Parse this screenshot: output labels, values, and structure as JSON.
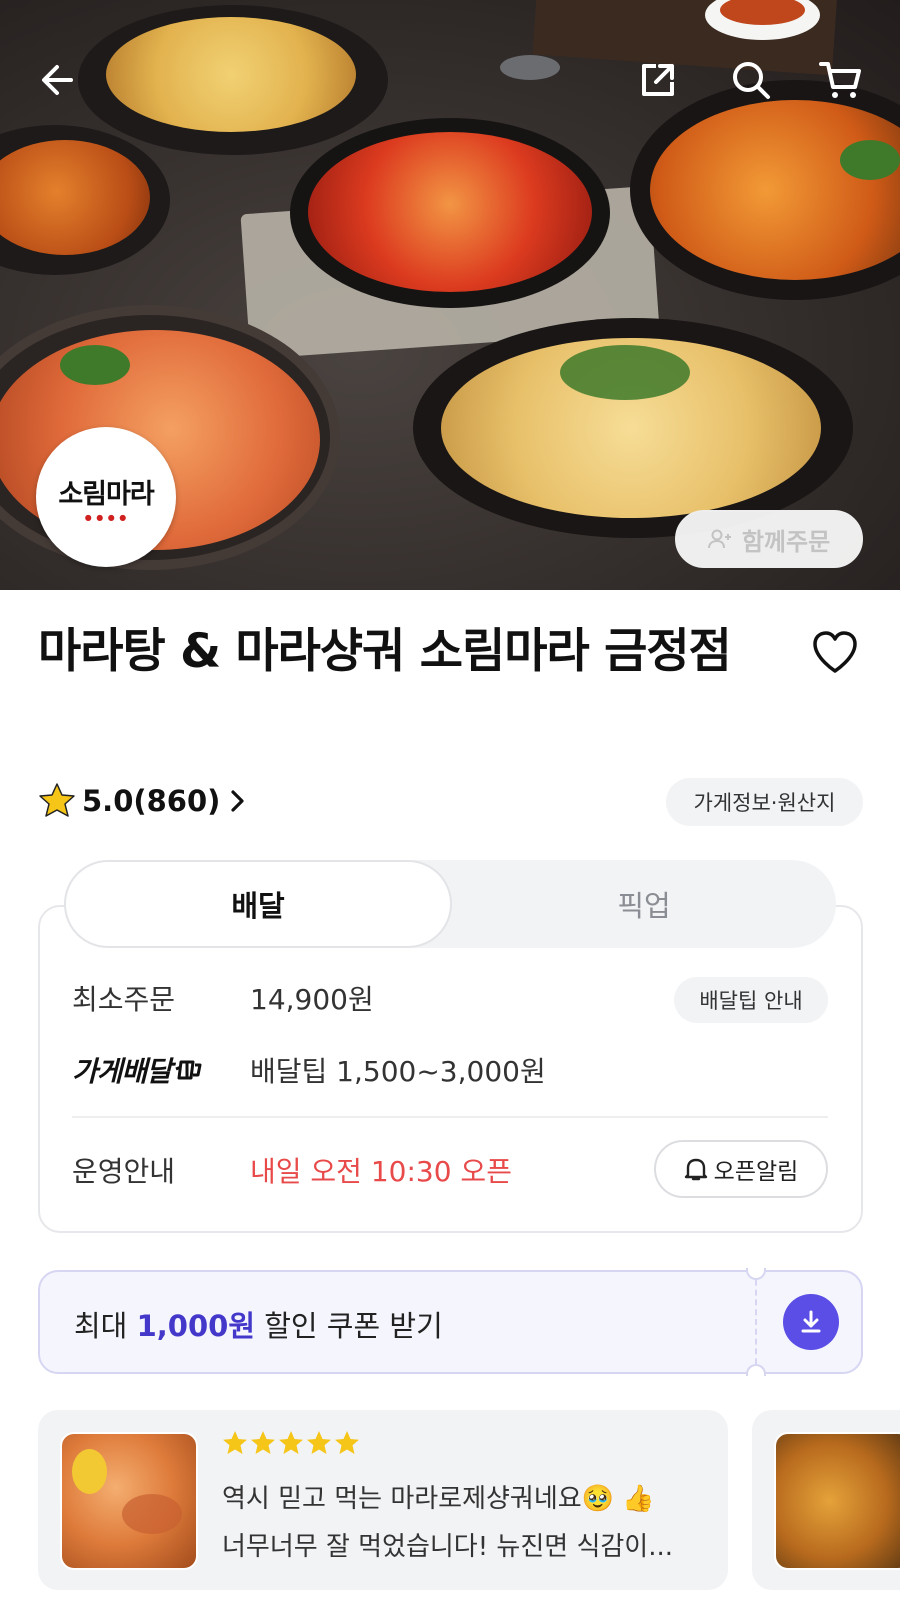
{
  "header": {
    "back_icon": "arrow-left-icon",
    "share_icon": "share-icon",
    "search_icon": "search-icon",
    "cart_icon": "cart-icon"
  },
  "hero": {
    "logo_text": "소림마라",
    "group_order_label": "함께주문"
  },
  "store": {
    "title": "마라탕 & 마라샹궈 소림마라 금정점",
    "rating": "5.0(860)",
    "info_chip": "가게정보·원산지"
  },
  "tabs": [
    {
      "label": "배달",
      "active": true
    },
    {
      "label": "픽업",
      "active": false
    }
  ],
  "delivery": {
    "min_order_label": "최소주문",
    "min_order_value": "14,900원",
    "tip_chip": "배달팁 안내",
    "store_delivery_label": "가게배달",
    "tip_value": "배달팁 1,500~3,000원",
    "hours_label": "운영안내",
    "hours_value": "내일 오전 10:30 오픈",
    "alert_label": "오픈알림"
  },
  "coupon": {
    "prefix": "최대 ",
    "amount": "1,000원",
    "suffix": " 할인 쿠폰 받기"
  },
  "review": {
    "stars": 5,
    "line1": "역시 믿고 먹는 마라로제샹궈네요🥹 👍",
    "line2": "너무너무 잘 먹었습니다! 뉴진면 식감이..."
  },
  "colors": {
    "accent": "#5b4ee6",
    "coupon_amount": "#4338ca",
    "open_time": "#e84a4a",
    "star": "#f5c518"
  }
}
